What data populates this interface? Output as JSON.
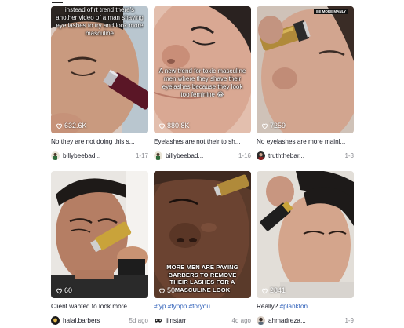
{
  "videos": [
    {
      "overlay": "instead of rt trend there's another video of a man shaving eye lashes to try and look more masculine",
      "likes": "632.6K",
      "caption": "No they are not doing this s...",
      "author": "billybeebad...",
      "date": "1-17"
    },
    {
      "overlay": "A new trend for toxic masculine men where they shave their eyelashes because they look too feminine 😂",
      "likes": "880.8K",
      "caption": "Eyelashes are not their to sh...",
      "author": "billybeebad...",
      "date": "1-16"
    },
    {
      "tag": "BE MORE MANLY",
      "likes": "7259",
      "caption": "No eyelashes are more mainl...",
      "author": "truththebar...",
      "date": "1-3"
    },
    {
      "likes": "60",
      "caption": "Client wanted to look more ...",
      "author": "halal.barbers",
      "date": "5d ago"
    },
    {
      "overlay": "MORE MEN ARE PAYING BARBERS TO REMOVE THEIR LASHES FOR A MASCULINE LOOK",
      "likes": "50",
      "caption": "#fyp #fyppp #foryou ...",
      "author": "jiinstarr",
      "date": "4d ago"
    },
    {
      "likes": "2841",
      "caption_plain": "Really? ",
      "caption_tag": "#plankton ...",
      "author": "ahmadreza...",
      "date": "1-9"
    }
  ],
  "colors": {
    "text": "#161823",
    "muted": "#8a8b91",
    "hashtag": "#2b5db8"
  },
  "icons": {
    "likes": "heart-outline-icon"
  }
}
